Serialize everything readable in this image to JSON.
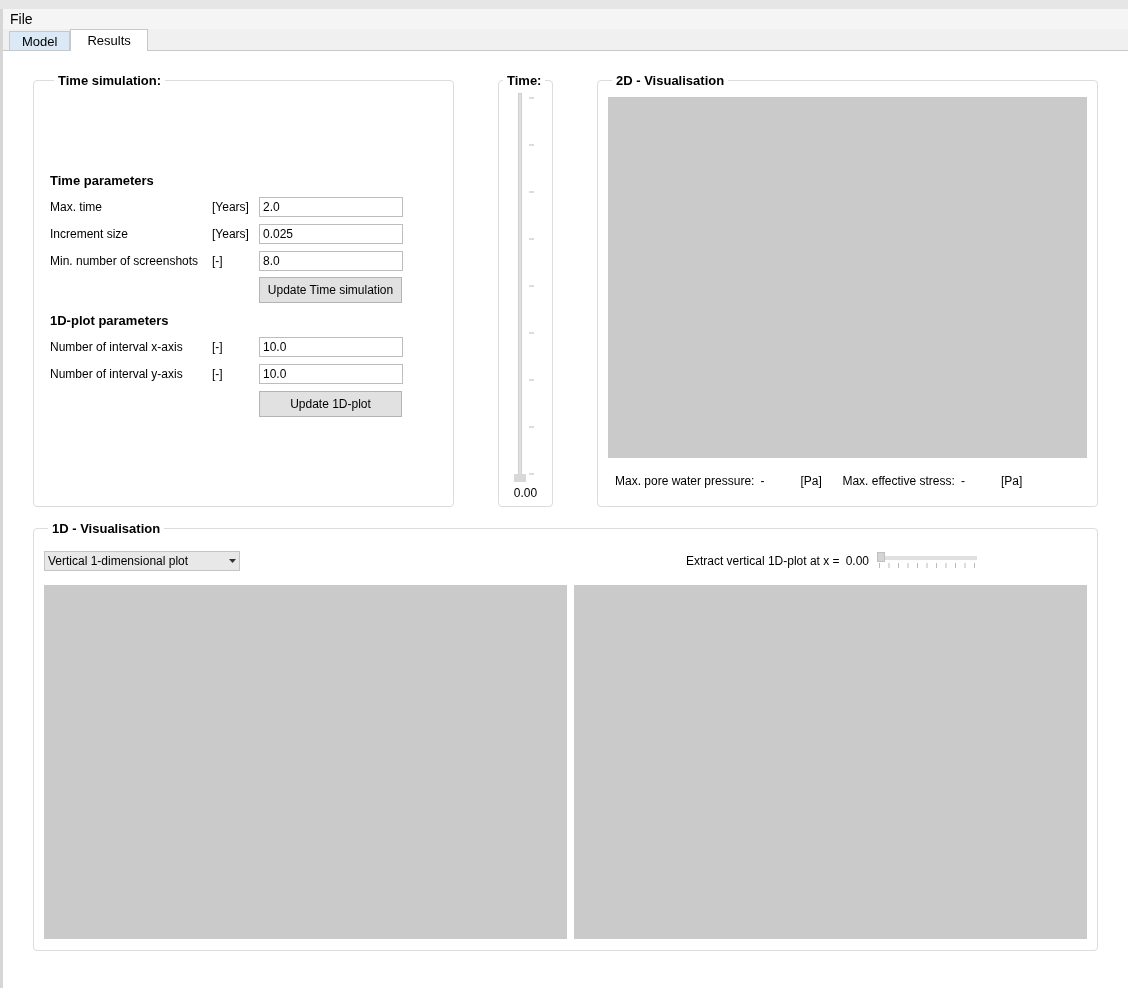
{
  "menu": [
    "File"
  ],
  "tabs": [
    {
      "label": "Model",
      "selected": false
    },
    {
      "label": "Results",
      "selected": true
    }
  ],
  "time_simulation": {
    "title": "Time simulation:",
    "sections": [
      {
        "title": "Time parameters",
        "rows": [
          {
            "label": "Max. time",
            "unit": "[Years]",
            "value": "2.0"
          },
          {
            "label": "Increment size",
            "unit": "[Years]",
            "value": "0.025"
          },
          {
            "label": "Min. number of screenshots",
            "unit": "[-]",
            "value": "8.0"
          }
        ],
        "button": "Update Time simulation"
      },
      {
        "title": "1D-plot parameters",
        "rows": [
          {
            "label": "Number of interval x-axis",
            "unit": "[-]",
            "value": "10.0"
          },
          {
            "label": "Number of interval y-axis",
            "unit": "[-]",
            "value": "10.0"
          }
        ],
        "button": "Update 1D-plot"
      }
    ]
  },
  "time": {
    "title": "Time:",
    "level": 0,
    "reading": "0.00"
  },
  "visualisation_2d": {
    "title": "2D - Visualisation",
    "stats": [
      {
        "label": "Max. pore water pressure:",
        "value": "-",
        "unit": "[Pa]"
      },
      {
        "label": "Max. effective stress:",
        "value": "-",
        "unit": "[Pa]"
      }
    ]
  },
  "visualisation_1d": {
    "title": "1D - Visualisation",
    "plot_type": "Vertical 1-dimensional plot",
    "extract_label": "Extract vertical 1D-plot at x =",
    "extract_value": "0.00",
    "level": 0
  }
}
